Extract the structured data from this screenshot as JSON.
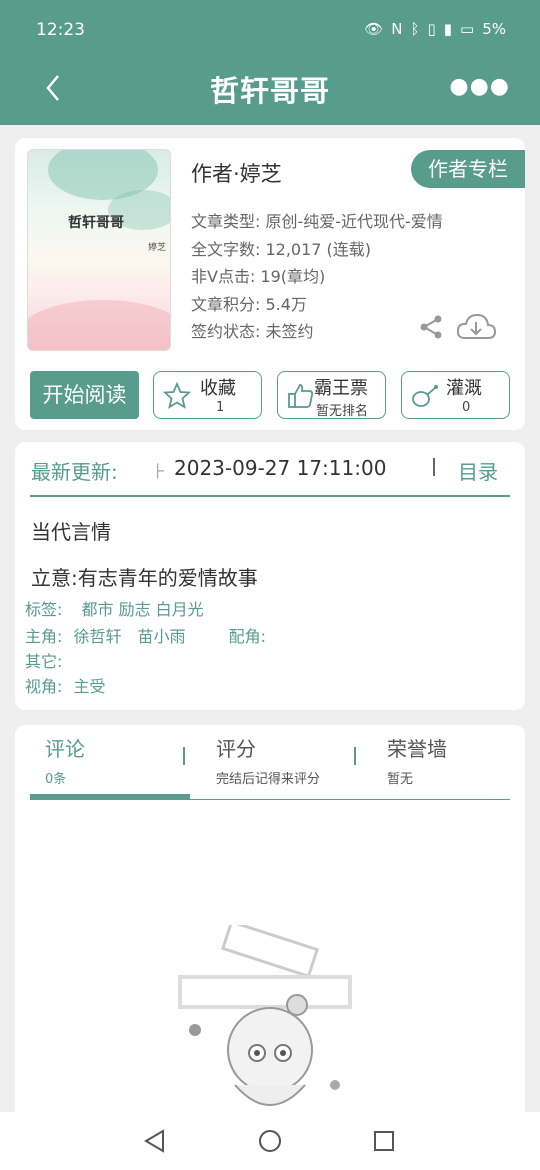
{
  "status_bar": {
    "time": "12:23",
    "battery": "5%"
  },
  "app_bar": {
    "title": "哲轩哥哥"
  },
  "book": {
    "cover_title": "哲轩哥哥",
    "cover_author": "婷芝",
    "author_line": "作者·婷芝",
    "author_column_label": "作者专栏",
    "meta": [
      "文章类型: 原创-纯爱-近代现代-爱情",
      "全文字数: 12,017 (连载)",
      "非V点击: 19(章均)",
      "文章积分: 5.4万",
      "签约状态: 未签约"
    ]
  },
  "actions": {
    "read_label": "开始阅读",
    "favorite": {
      "label": "收藏",
      "sub": "1"
    },
    "overlord": {
      "label": "霸王票",
      "sub": "暂无排名"
    },
    "irrigate": {
      "label": "灌溉",
      "sub": "0"
    }
  },
  "update": {
    "label": "最新更新:",
    "small": "⺊",
    "time": "2023-09-27 17:11:00",
    "toc_label": "目录"
  },
  "details": {
    "genre": "当代言情",
    "theme": "立意:有志青年的爱情故事",
    "tags_label": "标签:",
    "tags": "都市 励志 白月光",
    "lead_label": "主角:",
    "lead": "徐哲轩　苗小雨",
    "support_label": "配角:",
    "support": "",
    "other_label": "其它:",
    "other": "",
    "pov_label": "视角:",
    "pov": "主受"
  },
  "tabs": [
    {
      "title": "评论",
      "sub": "0条"
    },
    {
      "title": "评分",
      "sub": "完结后记得来评分"
    },
    {
      "title": "荣誉墙",
      "sub": "暂无"
    }
  ],
  "colors": {
    "accent": "#579c8d",
    "background": "#efefef"
  },
  "icons": [
    "back-icon",
    "more-icon",
    "share-icon",
    "download-icon",
    "star-icon",
    "thumb-icon",
    "watering-can-icon",
    "nav-back-icon",
    "nav-home-icon",
    "nav-recent-icon"
  ]
}
